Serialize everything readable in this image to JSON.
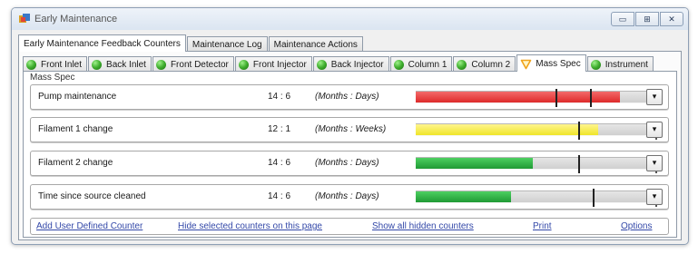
{
  "window": {
    "title": "Early Maintenance",
    "controls": [
      "▭",
      "⊞",
      "✕"
    ]
  },
  "main_tabs": [
    {
      "label": "Early Maintenance Feedback Counters",
      "active": true
    },
    {
      "label": "Maintenance Log",
      "active": false
    },
    {
      "label": "Maintenance Actions",
      "active": false
    }
  ],
  "module_tabs": [
    {
      "label": "Front Inlet",
      "status": "ok",
      "active": false
    },
    {
      "label": "Back Inlet",
      "status": "ok",
      "active": false
    },
    {
      "label": "Front Detector",
      "status": "ok",
      "active": false
    },
    {
      "label": "Front Injector",
      "status": "ok",
      "active": false
    },
    {
      "label": "Back Injector",
      "status": "ok",
      "active": false
    },
    {
      "label": "Column 1",
      "status": "ok",
      "active": false
    },
    {
      "label": "Column 2",
      "status": "ok",
      "active": false
    },
    {
      "label": "Mass Spec",
      "status": "warning",
      "active": true
    },
    {
      "label": "Instrument",
      "status": "ok",
      "active": false
    }
  ],
  "group_title": "Mass Spec",
  "counters": [
    {
      "name": "Pump maintenance",
      "value": "14 : 6",
      "units": "(Months : Days)",
      "bar_color": "#de2a2a",
      "fill_fraction": 0.84,
      "thresholds": [
        0.58,
        0.72
      ],
      "menu_label": "▾"
    },
    {
      "name": "Filament 1 change",
      "value": "12 : 1",
      "units": "(Months : Weeks)",
      "bar_color": "#efe52a",
      "fill_fraction": 0.75,
      "thresholds": [
        0.67,
        0.99
      ],
      "menu_label": "▾"
    },
    {
      "name": "Filament 2 change",
      "value": "14 : 6",
      "units": "(Months : Days)",
      "bar_color": "#1f9a34",
      "fill_fraction": 0.48,
      "thresholds": [
        0.67,
        0.99
      ],
      "menu_label": "▾"
    },
    {
      "name": "Time since source cleaned",
      "value": "14 : 6",
      "units": "(Months : Days)",
      "bar_color": "#1f9a34",
      "fill_fraction": 0.39,
      "thresholds": [
        0.73,
        0.99
      ],
      "menu_label": "▾"
    }
  ],
  "links": [
    "Add User Defined Counter",
    "Hide selected counters on this page",
    "Show all hidden counters",
    "Print",
    "Options"
  ]
}
